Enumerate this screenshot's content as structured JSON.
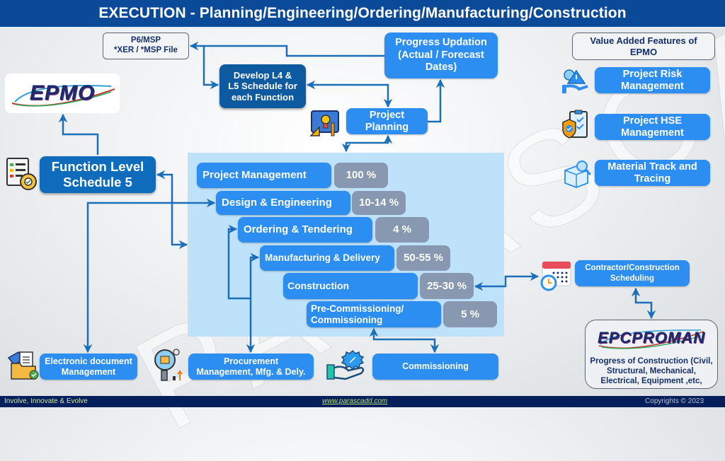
{
  "header": {
    "title": "EXECUTION  - Planning/Engineering/Ordering/Manufacturing/Construction"
  },
  "watermark": "PARASCADD",
  "nodes": {
    "p6_msp": {
      "line1": "P6/MSP",
      "line2": "*XER / *MSP File"
    },
    "develop_schedule": {
      "line1": "Develop L4 &",
      "line2": "L5 Schedule for",
      "line3": "each Function"
    },
    "progress_updation": {
      "line1": "Progress Updation",
      "line2": "(Actual / Forecast",
      "line3": "Dates)"
    },
    "project_planning": {
      "line1": "Project",
      "line2": "Planning"
    },
    "epmo_logo": "EPMO",
    "function_level": {
      "line1": "Function Level",
      "line2": "Schedule 5"
    },
    "electronic_doc": {
      "line1": "Electronic document",
      "line2": "Management"
    },
    "procurement": {
      "line1": "Procurement",
      "line2": "Management, Mfg. & Dely."
    },
    "commissioning": "Commissioning",
    "contractor_scheduling": {
      "line1": "Contractor/Construction",
      "line2": "Scheduling"
    },
    "epcproman_logo": "EPCPROMAN",
    "epcproman_desc": {
      "line1": "Progress of Construction  (Civil,",
      "line2": "Structural, Mechanical,",
      "line3": "Electrical, Equipment  ,etc,"
    }
  },
  "value_added": {
    "title_line1": "Value Added Features of",
    "title_line2": "EPMO",
    "items": [
      {
        "line1": "Project Risk",
        "line2": "Management",
        "icon": "risk-hand-icon"
      },
      {
        "line1": "Project HSE",
        "line2": "Management",
        "icon": "hse-checklist-icon"
      },
      {
        "line1": "Material Track and",
        "line2": "Tracing",
        "icon": "package-search-icon"
      }
    ]
  },
  "phases": [
    {
      "label": "Project Management",
      "share": "100 %"
    },
    {
      "label": "Design & Engineering",
      "share": "10-14 %"
    },
    {
      "label": "Ordering & Tendering",
      "share": "4 %"
    },
    {
      "label": "Manufacturing & Delivery",
      "share": "50-55 %"
    },
    {
      "label": "Construction",
      "share": "25-30 %"
    },
    {
      "label_line1": "Pre-Commissioning/",
      "label_line2": "Commissioning",
      "share": "5 %"
    }
  ],
  "colors": {
    "header_bg": "#0b4a98",
    "footer_bg": "#051f5c",
    "box_blue": "#2b8ef0",
    "box_navy": "#0d5aa0",
    "share_grey": "#8798b0",
    "panel_bg": "#bfe2fb",
    "connector": "#1a6fb8"
  },
  "footer": {
    "tagline": "Involve, Innovate & Evolve",
    "website": "www.parascadd.com",
    "copyright": "Copyrights © 2023"
  }
}
